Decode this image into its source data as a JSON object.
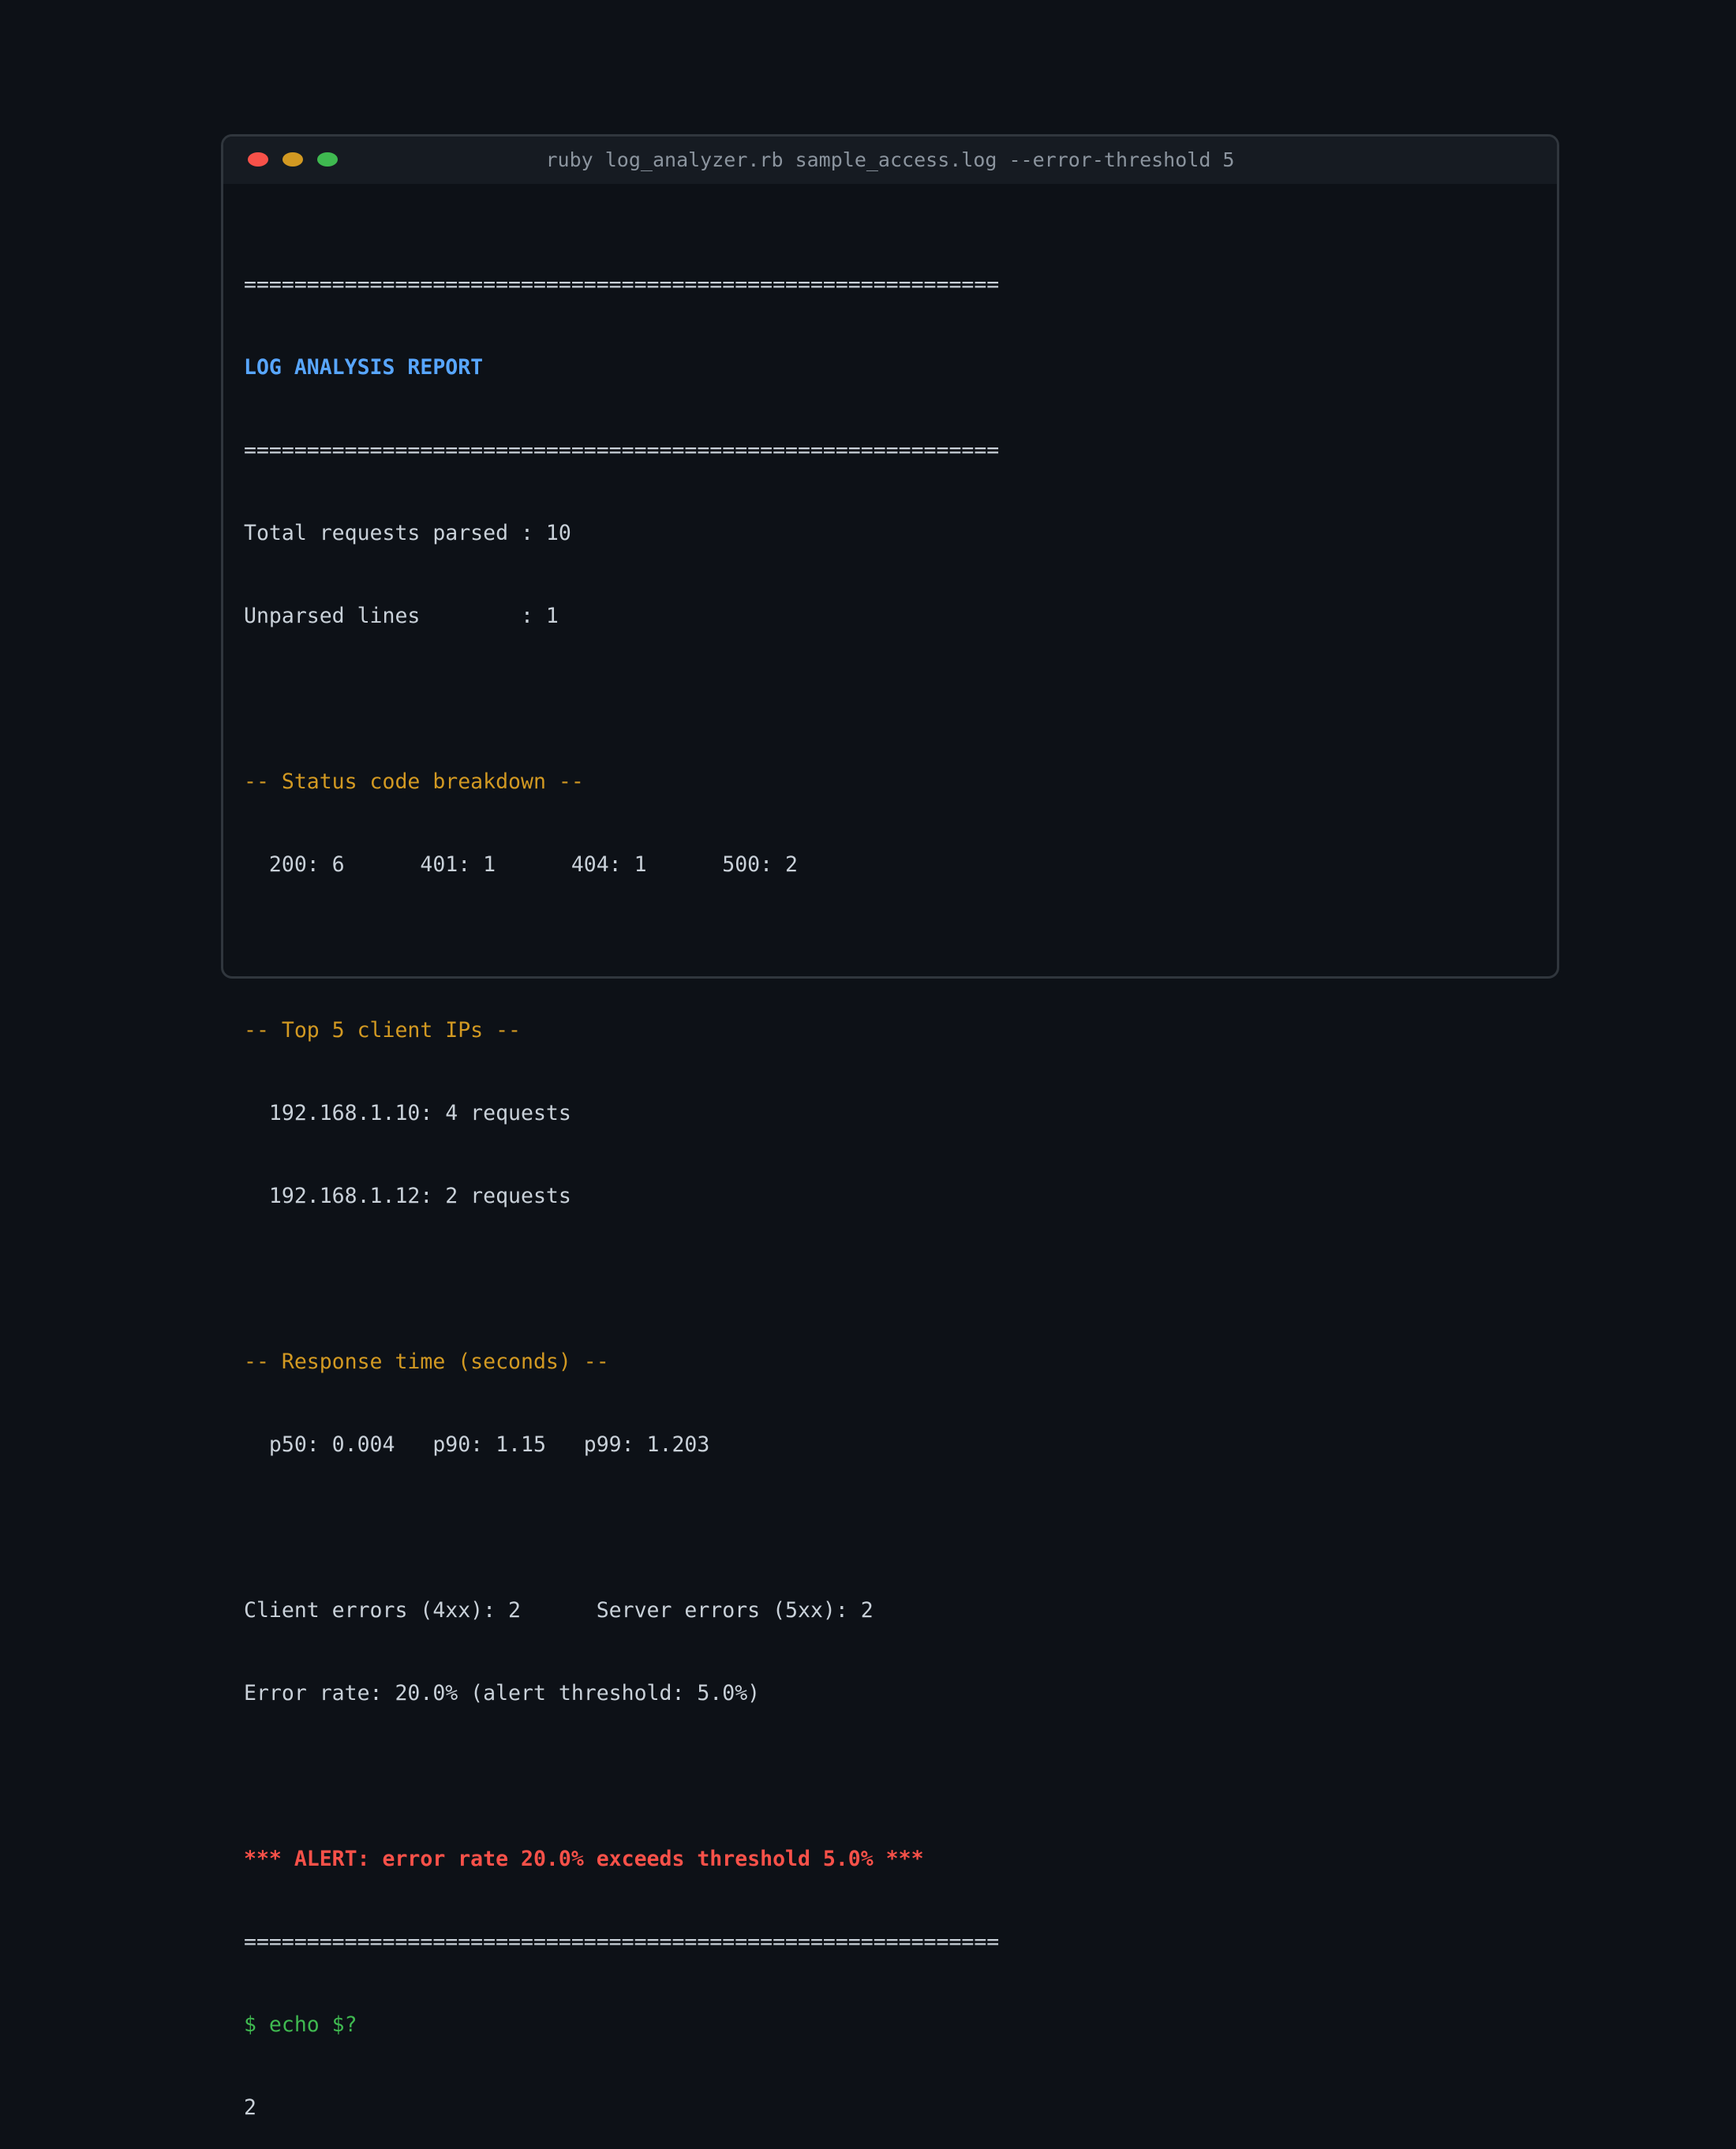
{
  "window": {
    "title": "ruby log_analyzer.rb sample_access.log --error-threshold 5",
    "controls": [
      {
        "name": "close",
        "color": "#f85149"
      },
      {
        "name": "minimize",
        "color": "#d29922"
      },
      {
        "name": "maximize",
        "color": "#3fb950"
      }
    ]
  },
  "colors": {
    "background": "#0d1117",
    "text": "#c9d1d9",
    "title_accent": "#58a6ff",
    "section_accent": "#d29922",
    "alert": "#f85149",
    "prompt": "#3fb950"
  },
  "report": {
    "rule": "============================================================",
    "title": "LOG ANALYSIS REPORT",
    "total_requests_line": "Total requests parsed : 10",
    "unparsed_lines_line": "Unparsed lines        : 1",
    "status_heading": "-- Status code breakdown --",
    "status_codes_line": "  200: 6      401: 1      404: 1      500: 2",
    "top_ips_heading": "-- Top 5 client IPs --",
    "top_ips": [
      "  192.168.1.10: 4 requests",
      "  192.168.1.12: 2 requests"
    ],
    "response_time_heading": "-- Response time (seconds) --",
    "percentiles_line": "  p50: 0.004   p90: 1.15   p99: 1.203",
    "errors_line": "Client errors (4xx): 2      Server errors (5xx): 2",
    "error_rate_line": "Error rate: 20.0% (alert threshold: 5.0%)",
    "alert_line": "*** ALERT: error rate 20.0% exceeds threshold 5.0% ***"
  },
  "shell": {
    "command_line": "$ echo $?",
    "output": "2"
  }
}
